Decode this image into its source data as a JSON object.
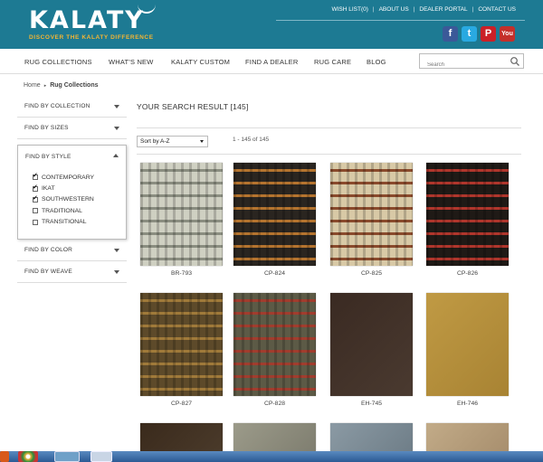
{
  "brand": {
    "name": "KALATY",
    "tagline": "DISCOVER THE KALATY DIFFERENCE"
  },
  "toplinks": [
    "WISH LIST(0)",
    "ABOUT US",
    "DEALER PORTAL",
    "CONTACT US"
  ],
  "social": [
    {
      "name": "facebook",
      "glyph": "f",
      "color": "#3b5998"
    },
    {
      "name": "twitter",
      "glyph": "t",
      "color": "#29a9e1"
    },
    {
      "name": "pinterest",
      "glyph": "P",
      "color": "#cb2027"
    },
    {
      "name": "youtube",
      "glyph": "Y",
      "color": "#c4302b"
    }
  ],
  "nav": [
    "RUG COLLECTIONS",
    "WHAT'S NEW",
    "KALATY CUSTOM",
    "FIND A DEALER",
    "RUG CARE",
    "BLOG"
  ],
  "search": {
    "placeholder": "Search"
  },
  "breadcrumb": {
    "home": "Home",
    "current": "Rug Collections"
  },
  "filters": {
    "collection": "FIND BY COLLECTION",
    "sizes": "FIND BY SIZES",
    "style": "FIND BY STYLE",
    "color": "FIND BY COLOR",
    "weave": "FIND BY WEAVE",
    "style_options": [
      {
        "label": "CONTEMPORARY",
        "checked": true
      },
      {
        "label": "IKAT",
        "checked": true
      },
      {
        "label": "SOUTHWESTERN",
        "checked": true
      },
      {
        "label": "TRADITIONAL",
        "checked": false
      },
      {
        "label": "TRANSITIONAL",
        "checked": false
      }
    ]
  },
  "results": {
    "title": "YOUR SEARCH RESULT [145]",
    "sort": "Sort by A-Z",
    "count": "1 - 145 of 145"
  },
  "products": [
    {
      "sku": "BR-793",
      "c1": "#cfd0c2",
      "c2": "#8a8d80"
    },
    {
      "sku": "CP-824",
      "c1": "#2a2520",
      "c2": "#b5742f"
    },
    {
      "sku": "CP-825",
      "c1": "#d8c9a6",
      "c2": "#8a4a2c"
    },
    {
      "sku": "CP-826",
      "c1": "#1f1a16",
      "c2": "#b0362c"
    },
    {
      "sku": "CP-827",
      "c1": "#5d4a2a",
      "c2": "#a07a3a"
    },
    {
      "sku": "CP-828",
      "c1": "#5c5a46",
      "c2": "#a13d2e"
    },
    {
      "sku": "EH-745",
      "c1": "#3a2a22",
      "c2": "#4a3a30"
    },
    {
      "sku": "EH-746",
      "c1": "#c09a44",
      "c2": "#a88333"
    },
    {
      "sku": "",
      "c1": "#3a2a1c",
      "c2": "#4a3a2a"
    },
    {
      "sku": "",
      "c1": "#9c9b8a",
      "c2": "#7f7e70"
    },
    {
      "sku": "",
      "c1": "#8b9aa4",
      "c2": "#6f7e88"
    },
    {
      "sku": "",
      "c1": "#c2ab88",
      "c2": "#a88f6e"
    }
  ]
}
